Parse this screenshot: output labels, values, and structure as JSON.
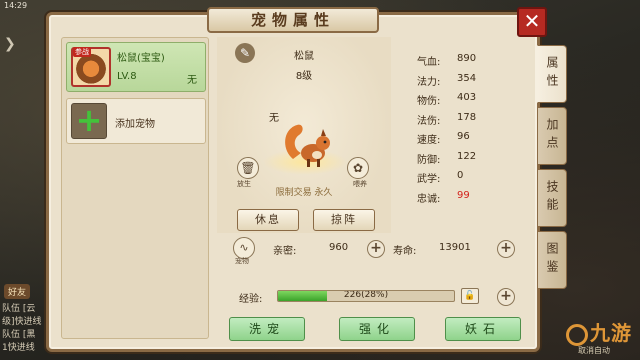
{
  "status": {
    "time": "14:29"
  },
  "window": {
    "title": "宠物属性",
    "close": "✕"
  },
  "pet_list": {
    "selected": {
      "badge": "参战",
      "name": "松鼠(宝宝)",
      "level": "LV.8",
      "status": "无"
    },
    "add_label": "添加宠物"
  },
  "pet": {
    "name": "松鼠",
    "level": "8级",
    "prefix": "无",
    "release_label": "放生",
    "feed_label": "喂养",
    "trade_note": "限制交易 永久",
    "rest_label": "休息",
    "battle_label": "掠阵"
  },
  "stats": [
    {
      "label": "气血:",
      "value": "890"
    },
    {
      "label": "法力:",
      "value": "354"
    },
    {
      "label": "物伤:",
      "value": "403"
    },
    {
      "label": "法伤:",
      "value": "178"
    },
    {
      "label": "速度:",
      "value": "96"
    },
    {
      "label": "防御:",
      "value": "122"
    },
    {
      "label": "武学:",
      "value": "0"
    },
    {
      "label": "忠诚:",
      "value": "99"
    }
  ],
  "bond": {
    "icon_label": "宠物",
    "affinity_label": "亲密:",
    "affinity_value": "960",
    "life_label": "寿命:",
    "life_value": "13901"
  },
  "experience": {
    "label": "经验:",
    "text": "226(28%)",
    "fraction": 0.28
  },
  "actions": [
    "洗宠",
    "强化",
    "妖石"
  ],
  "tabs": [
    "属性",
    "加点",
    "技能",
    "图鉴"
  ],
  "hud": {
    "friend": "好友",
    "lines": [
      "队伍 [云",
      "级]快进线",
      "队伍 [黑",
      "1快进线"
    ],
    "watermark": "九游",
    "auto": "取消自动"
  },
  "colors": {
    "accent_red": "#d3221b",
    "green_button": "#8fd38b",
    "frame": "#8a6a45"
  }
}
